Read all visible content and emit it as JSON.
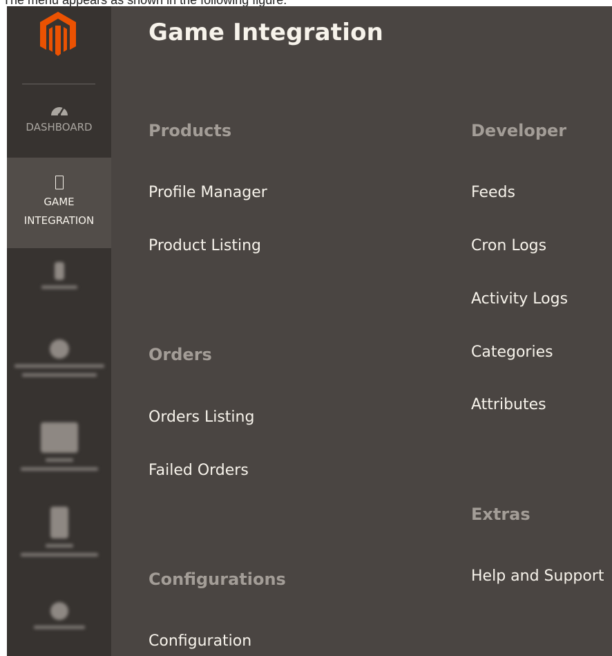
{
  "caption": "The menu appears as shown in the following figure.",
  "colors": {
    "sidebar_bg": "#373330",
    "sidebar_active_bg": "#524d49",
    "panel_bg": "#4a4542",
    "logo_orange": "#eb5202",
    "section_title": "#a39d97",
    "link_text": "#f7f3eb"
  },
  "sidebar": {
    "logo_icon": "magento-logo-icon",
    "items": [
      {
        "label": "DASHBOARD",
        "icon": "speedometer-icon",
        "active": false
      },
      {
        "label_line1": "GAME",
        "label_line2": "INTEGRATION",
        "icon": "rectangle-icon",
        "active": true
      }
    ]
  },
  "panel": {
    "title": "Game Integration",
    "sections": [
      {
        "title": "Products",
        "links": [
          "Profile Manager",
          "Product Listing"
        ]
      },
      {
        "title": "Orders",
        "links": [
          "Orders Listing",
          "Failed Orders"
        ]
      },
      {
        "title": "Configurations",
        "links": [
          "Configuration"
        ]
      },
      {
        "title": "Developer",
        "links": [
          "Feeds",
          "Cron Logs",
          "Activity Logs",
          "Categories",
          "Attributes"
        ]
      },
      {
        "title": "Extras",
        "links": [
          "Help and Support"
        ]
      }
    ]
  }
}
